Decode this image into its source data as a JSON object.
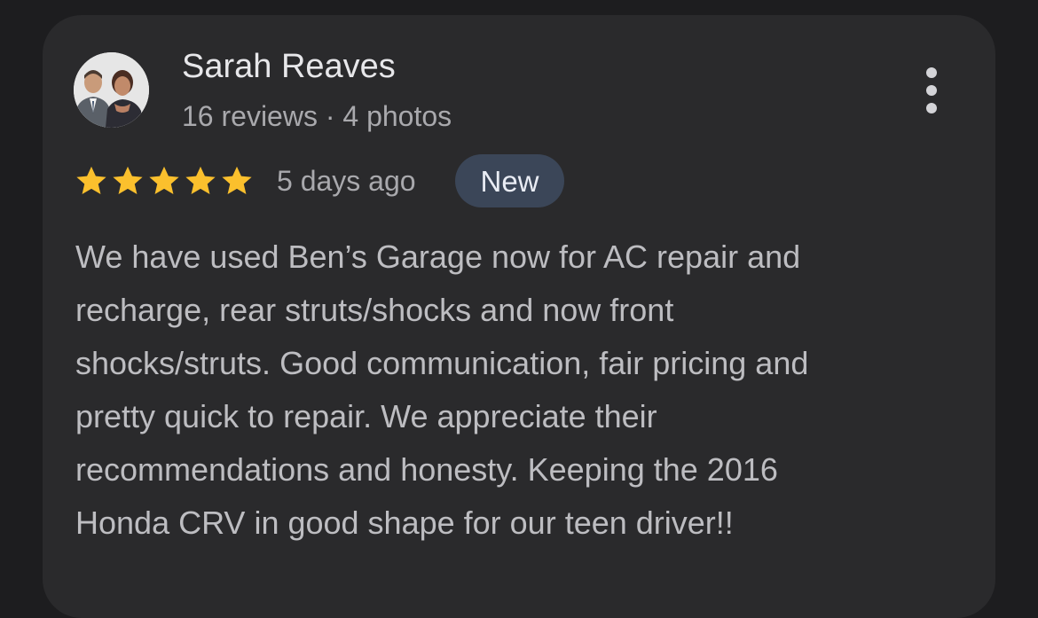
{
  "review": {
    "author": {
      "name": "Sarah Reaves",
      "meta": "16 reviews · 4 photos"
    },
    "rating": 5,
    "rating_max": 5,
    "date": "5 days ago",
    "badge": "New",
    "text_lines": [
      "We have used Ben’s Garage now for AC repair and",
      "recharge, rear struts/shocks and now front",
      "shocks/struts. Good communication, fair pricing and",
      "pretty quick to repair. We appreciate their",
      "recommendations and honesty. Keeping the 2016",
      "Honda CRV in good shape for our teen driver!!"
    ]
  },
  "icons": {
    "more": "more-vert-icon",
    "star": "star-icon"
  },
  "colors": {
    "background": "#1d1d1f",
    "card": "#2a2a2c",
    "star": "#fbc02d",
    "badge_bg": "#3b4658"
  }
}
